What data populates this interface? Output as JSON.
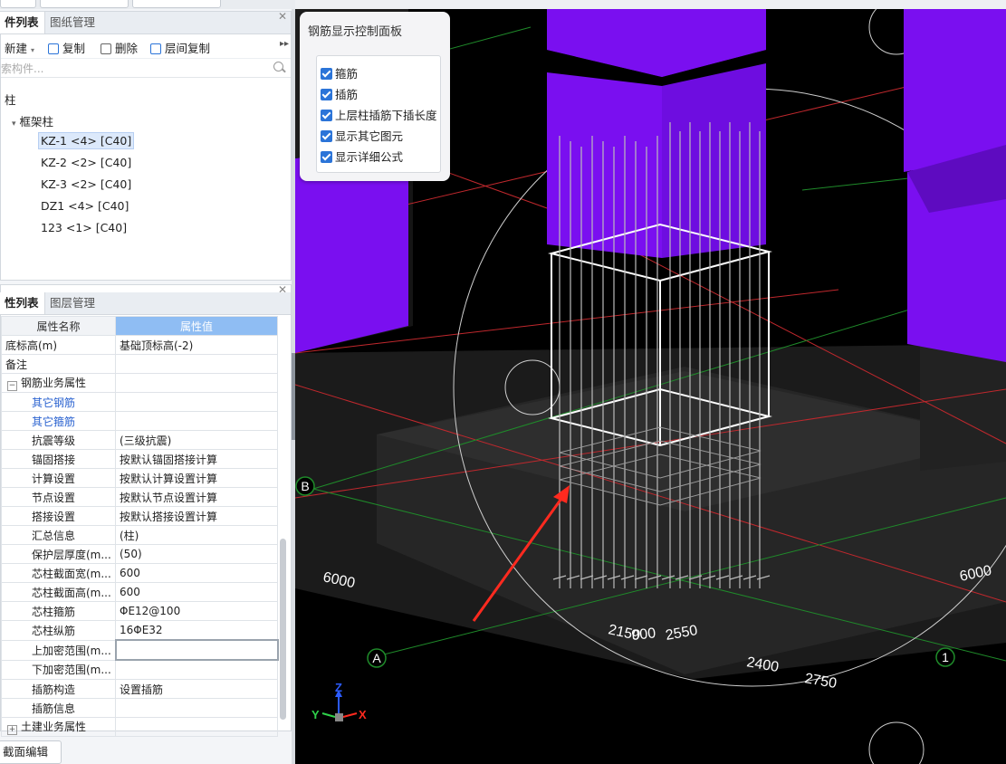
{
  "left_panel": {
    "tabs": [
      "件列表",
      "图纸管理"
    ],
    "toolbar": {
      "new": "新建",
      "copy": "复制",
      "delete": "删除",
      "floor_copy": "层间复制"
    },
    "search_placeholder": "索构件...",
    "tree": {
      "root": "柱",
      "group": "框架柱",
      "items": [
        "KZ-1 <4> [C40]",
        "KZ-2 <2> [C40]",
        "KZ-3 <2> [C40]",
        "DZ1 <4> [C40]",
        "123 <1> [C40]"
      ]
    }
  },
  "props_panel": {
    "tabs": [
      "性列表",
      "图层管理"
    ],
    "header": {
      "name": "属性名称",
      "value": "属性值"
    },
    "rows": [
      {
        "name": "底标高(m)",
        "value": "基础顶标高(-2)"
      },
      {
        "name": "备注",
        "value": ""
      },
      {
        "name": "钢筋业务属性",
        "value": "",
        "expander": "−"
      },
      {
        "name": "其它钢筋",
        "value": ""
      },
      {
        "name": "其它箍筋",
        "value": ""
      },
      {
        "name": "抗震等级",
        "value": "(三级抗震)"
      },
      {
        "name": "锚固搭接",
        "value": "按默认锚固搭接计算"
      },
      {
        "name": "计算设置",
        "value": "按默认计算设置计算"
      },
      {
        "name": "节点设置",
        "value": "按默认节点设置计算"
      },
      {
        "name": "搭接设置",
        "value": "按默认搭接设置计算"
      },
      {
        "name": "汇总信息",
        "value": "(柱)"
      },
      {
        "name": "保护层厚度(m...",
        "value": "(50)"
      },
      {
        "name": "芯柱截面宽(m...",
        "value": "600"
      },
      {
        "name": "芯柱截面高(m...",
        "value": "600"
      },
      {
        "name": "芯柱箍筋",
        "value": "ΦE12@100"
      },
      {
        "name": "芯柱纵筋",
        "value": "16ΦE32"
      },
      {
        "name": "上加密范围(m...",
        "value": ""
      },
      {
        "name": "下加密范围(m...",
        "value": ""
      },
      {
        "name": "插筋构造",
        "value": "设置插筋"
      },
      {
        "name": "插筋信息",
        "value": ""
      },
      {
        "name": "土建业务属性",
        "value": "",
        "expander": "+"
      }
    ],
    "bottom_button": "截面编辑"
  },
  "control_panel": {
    "title": "钢筋显示控制面板",
    "options": [
      {
        "label": "箍筋",
        "checked": true
      },
      {
        "label": "插筋",
        "checked": true
      },
      {
        "label": "上层柱插筋下插长度",
        "checked": true
      },
      {
        "label": "显示其它图元",
        "checked": true
      },
      {
        "label": "显示详细公式",
        "checked": true
      }
    ]
  },
  "viewport": {
    "axis_labels": [
      "B",
      "A",
      "1"
    ],
    "dimensions": [
      "6000",
      "6000",
      "2150",
      "900",
      "2550",
      "2400",
      "2750"
    ],
    "gizmo": {
      "x": "X",
      "y": "Y",
      "z": "Z"
    },
    "colors": {
      "column": "#7a0ff0",
      "column_top": "#5e0bc0",
      "grid_red": "#c0282d",
      "grid_green": "#1f8b2a",
      "arrow": "#ff2a1f"
    }
  }
}
